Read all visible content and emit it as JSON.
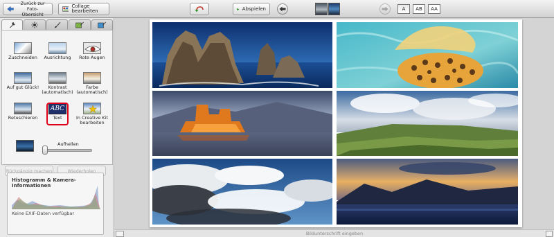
{
  "toolbar": {
    "back_label_line1": "Zurück zur Foto-",
    "back_label_line2": "Übersicht",
    "collage_label": "Collage bearbeiten",
    "play_label": "Abspielen",
    "text_size_small": "A",
    "text_size_medium": "AB",
    "text_size_large": "AA"
  },
  "tabs": [
    {
      "icon": "wrench-icon",
      "active": true
    },
    {
      "icon": "sun-icon",
      "active": false
    },
    {
      "icon": "brush-icon",
      "active": false
    },
    {
      "icon": "picture-brush-icon",
      "active": false
    },
    {
      "icon": "magic-icon",
      "active": false
    }
  ],
  "tools": {
    "crop": "Zuschneiden",
    "straighten": "Ausrichtung",
    "red_eye": "Rote Augen",
    "lucky": "Auf gut Glück!",
    "contrast_1": "Kontrast",
    "contrast_2": "(automatisch)",
    "color_1": "Farbe",
    "color_2": "(automatisch)",
    "retouch": "Retuschieren",
    "text": "Text",
    "text_icon_label": "ABC",
    "creative_kit_1": "In Creative Kit",
    "creative_kit_2": "bearbeiten",
    "fill_light": "Aufhellen"
  },
  "fill_light_value": 0.0,
  "actions": {
    "undo": "Rückgängig machen",
    "redo": "Wiederholen"
  },
  "histogram": {
    "title": "Histogramm & Kamera-Informationen",
    "exif_text": "Keine EXIF-Daten verfügbar"
  },
  "caption": {
    "placeholder": "Bildunterschrift eingeben"
  },
  "colors": {
    "selection_ring": "#e0001a",
    "play_green": "#2e9a2e",
    "back_arrow_blue": "#2f6fc4"
  }
}
